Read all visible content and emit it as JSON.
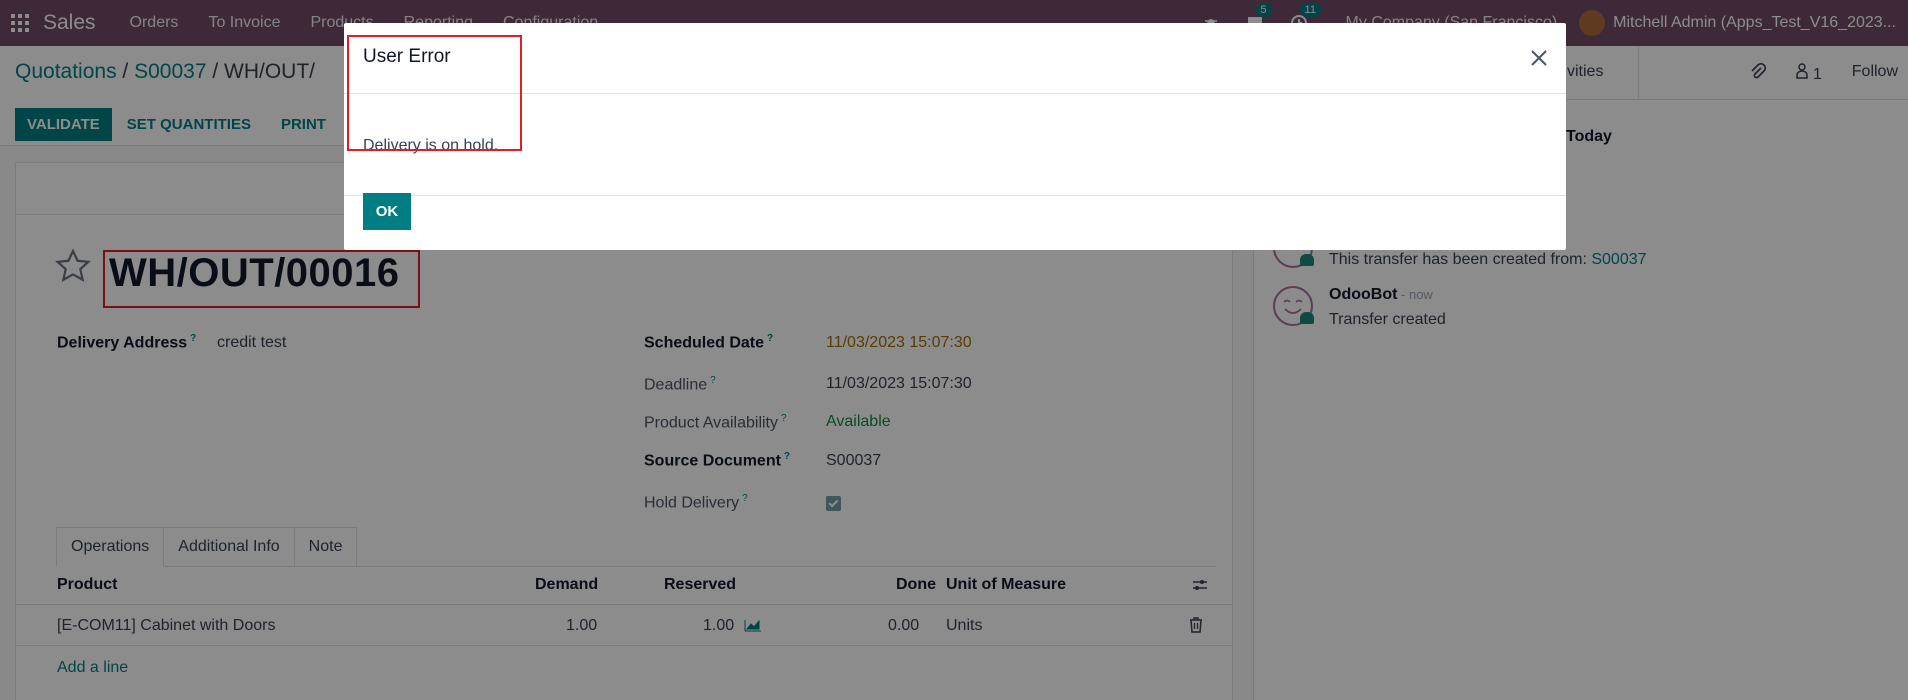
{
  "navbar": {
    "app_name": "Sales",
    "menu": [
      "Orders",
      "To Invoice",
      "Products",
      "Reporting",
      "Configuration"
    ],
    "messages_count": "5",
    "activities_count": "11",
    "company": "My Company (San Francisco)",
    "user": "Mitchell Admin (Apps_Test_V16_2023..."
  },
  "breadcrumb": {
    "item1": "Quotations",
    "sep1": " / ",
    "item2": "S00037",
    "sep2": " / ",
    "current": "WH/OUT/"
  },
  "actions": {
    "validate": "VALIDATE",
    "set_quantities": "SET QUANTITIES",
    "print": "PRINT"
  },
  "chatter_top": {
    "activities": "tivities",
    "followers_count": "1",
    "follow": "Follow"
  },
  "record": {
    "title": "WH/OUT/00016",
    "delivery_address_label": "Delivery Address",
    "delivery_address": "credit test",
    "scheduled_date_label": "Scheduled Date",
    "scheduled_date": "11/03/2023 15:07:30",
    "deadline_label": "Deadline",
    "deadline": "11/03/2023 15:07:30",
    "availability_label": "Product Availability",
    "availability": "Available",
    "source_label": "Source Document",
    "source": "S00037",
    "hold_label": "Hold Delivery",
    "hold_checked": true,
    "help": "?"
  },
  "tabs": [
    "Operations",
    "Additional Info",
    "Note"
  ],
  "table": {
    "headers": {
      "product": "Product",
      "demand": "Demand",
      "reserved": "Reserved",
      "done": "Done",
      "uom": "Unit of Measure"
    },
    "rows": [
      {
        "product": "[E-COM11] Cabinet with Doors",
        "demand": "1.00",
        "reserved": "1.00",
        "done": "0.00",
        "uom": "Units"
      }
    ],
    "add_line": "Add a line"
  },
  "chatter": {
    "today": "Today",
    "msg1_text": "This transfer has been created from: ",
    "msg1_link": "S00037",
    "msg2_author": "OdooBot",
    "msg2_time": " - now",
    "msg2_text": "Transfer created"
  },
  "modal": {
    "title": "User Error",
    "message": "Delivery is on hold.",
    "ok": "OK"
  },
  "colors": {
    "navbar": "#714b67",
    "primary": "#017e84",
    "highlight": "#e11d27"
  }
}
